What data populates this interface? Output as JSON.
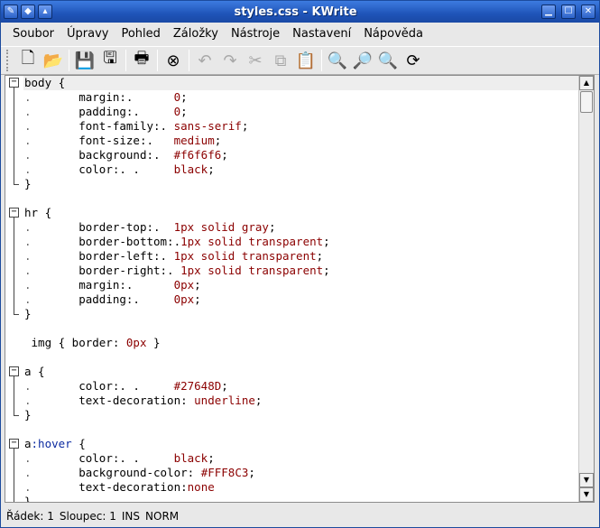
{
  "window": {
    "title": "styles.css - KWrite"
  },
  "menu": [
    "Soubor",
    "Úpravy",
    "Pohled",
    "Záložky",
    "Nástroje",
    "Nastavení",
    "Nápověda"
  ],
  "toolbar": [
    {
      "name": "new-document-icon",
      "glyph": "🗋",
      "enabled": true
    },
    {
      "name": "open-folder-icon",
      "glyph": "📂",
      "enabled": true
    },
    {
      "sep": true
    },
    {
      "name": "save-icon",
      "glyph": "💾",
      "enabled": true
    },
    {
      "name": "save-as-icon",
      "glyph": "🖫",
      "enabled": true
    },
    {
      "sep": true
    },
    {
      "name": "print-icon",
      "glyph": "🖶",
      "enabled": true
    },
    {
      "sep": true
    },
    {
      "name": "close-document-icon",
      "glyph": "⊗",
      "enabled": true
    },
    {
      "sep": true
    },
    {
      "name": "undo-icon",
      "glyph": "↶",
      "enabled": false
    },
    {
      "name": "redo-icon",
      "glyph": "↷",
      "enabled": false
    },
    {
      "name": "cut-icon",
      "glyph": "✂",
      "enabled": false
    },
    {
      "name": "copy-icon",
      "glyph": "⧉",
      "enabled": false
    },
    {
      "name": "paste-icon",
      "glyph": "📋",
      "enabled": true
    },
    {
      "sep": true
    },
    {
      "name": "find-icon",
      "glyph": "🔍",
      "enabled": true
    },
    {
      "name": "find-next-icon",
      "glyph": "🔎",
      "enabled": true
    },
    {
      "name": "find-previous-icon",
      "glyph": "🔍",
      "enabled": true
    },
    {
      "name": "replace-icon",
      "glyph": "⟳",
      "enabled": true
    }
  ],
  "code_lines": [
    [
      {
        "t": "body {",
        "c": "k"
      }
    ],
    [
      {
        "t": ".       ",
        "c": "tabmark"
      },
      {
        "t": "margin:.      ",
        "c": "k"
      },
      {
        "t": "0",
        "c": "v"
      },
      {
        "t": ";",
        "c": "k"
      }
    ],
    [
      {
        "t": ".       ",
        "c": "tabmark"
      },
      {
        "t": "padding:.     ",
        "c": "k"
      },
      {
        "t": "0",
        "c": "v"
      },
      {
        "t": ";",
        "c": "k"
      }
    ],
    [
      {
        "t": ".       ",
        "c": "tabmark"
      },
      {
        "t": "font-family:. ",
        "c": "k"
      },
      {
        "t": "sans-serif",
        "c": "v"
      },
      {
        "t": ";",
        "c": "k"
      }
    ],
    [
      {
        "t": ".       ",
        "c": "tabmark"
      },
      {
        "t": "font-size:.   ",
        "c": "k"
      },
      {
        "t": "medium",
        "c": "v"
      },
      {
        "t": ";",
        "c": "k"
      }
    ],
    [
      {
        "t": ".       ",
        "c": "tabmark"
      },
      {
        "t": "background:.  ",
        "c": "k"
      },
      {
        "t": "#f6f6f6",
        "c": "v"
      },
      {
        "t": ";",
        "c": "k"
      }
    ],
    [
      {
        "t": ".       ",
        "c": "tabmark"
      },
      {
        "t": "color:. .     ",
        "c": "k"
      },
      {
        "t": "black",
        "c": "v"
      },
      {
        "t": ";",
        "c": "k"
      }
    ],
    [
      {
        "t": "}",
        "c": "k"
      }
    ],
    [],
    [
      {
        "t": "hr {",
        "c": "k"
      }
    ],
    [
      {
        "t": ".       ",
        "c": "tabmark"
      },
      {
        "t": "border-top:.  ",
        "c": "k"
      },
      {
        "t": "1px solid gray",
        "c": "v"
      },
      {
        "t": ";",
        "c": "k"
      }
    ],
    [
      {
        "t": ".       ",
        "c": "tabmark"
      },
      {
        "t": "border-bottom:.",
        "c": "k"
      },
      {
        "t": "1px solid transparent",
        "c": "v"
      },
      {
        "t": ";",
        "c": "k"
      }
    ],
    [
      {
        "t": ".       ",
        "c": "tabmark"
      },
      {
        "t": "border-left:. ",
        "c": "k"
      },
      {
        "t": "1px solid transparent",
        "c": "v"
      },
      {
        "t": ";",
        "c": "k"
      }
    ],
    [
      {
        "t": ".       ",
        "c": "tabmark"
      },
      {
        "t": "border-right:.",
        "c": "k"
      },
      {
        "t": " 1px solid transparent",
        "c": "v"
      },
      {
        "t": ";",
        "c": "k"
      }
    ],
    [
      {
        "t": ".       ",
        "c": "tabmark"
      },
      {
        "t": "margin:.      ",
        "c": "k"
      },
      {
        "t": "0px",
        "c": "v"
      },
      {
        "t": ";",
        "c": "k"
      }
    ],
    [
      {
        "t": ".       ",
        "c": "tabmark"
      },
      {
        "t": "padding:.     ",
        "c": "k"
      },
      {
        "t": "0px",
        "c": "v"
      },
      {
        "t": ";",
        "c": "k"
      }
    ],
    [
      {
        "t": "}",
        "c": "k"
      }
    ],
    [],
    [
      {
        "t": " img { border: ",
        "c": "k"
      },
      {
        "t": "0px",
        "c": "v"
      },
      {
        "t": " }",
        "c": "k"
      }
    ],
    [],
    [
      {
        "t": "a {",
        "c": "k"
      }
    ],
    [
      {
        "t": ".       ",
        "c": "tabmark"
      },
      {
        "t": "color:. .     ",
        "c": "k"
      },
      {
        "t": "#27648D",
        "c": "v"
      },
      {
        "t": ";",
        "c": "k"
      }
    ],
    [
      {
        "t": ".       ",
        "c": "tabmark"
      },
      {
        "t": "text-decoration: ",
        "c": "k"
      },
      {
        "t": "underline",
        "c": "v"
      },
      {
        "t": ";",
        "c": "k"
      }
    ],
    [
      {
        "t": "}",
        "c": "k"
      }
    ],
    [],
    [
      {
        "t": "a",
        "c": "k"
      },
      {
        "t": ":hover",
        "c": "sel"
      },
      {
        "t": " {",
        "c": "k"
      }
    ],
    [
      {
        "t": ".       ",
        "c": "tabmark"
      },
      {
        "t": "color:. .     ",
        "c": "k"
      },
      {
        "t": "black",
        "c": "v"
      },
      {
        "t": ";",
        "c": "k"
      }
    ],
    [
      {
        "t": ".       ",
        "c": "tabmark"
      },
      {
        "t": "background-color: ",
        "c": "k"
      },
      {
        "t": "#FFF8C3",
        "c": "v"
      },
      {
        "t": ";",
        "c": "k"
      }
    ],
    [
      {
        "t": ".       ",
        "c": "tabmark"
      },
      {
        "t": "text-decoration:",
        "c": "k"
      },
      {
        "t": "none",
        "c": "v"
      }
    ],
    [
      {
        "t": "}",
        "c": "k"
      }
    ]
  ],
  "folds": [
    [
      0,
      7
    ],
    [
      9,
      16
    ],
    [
      20,
      23
    ],
    [
      25,
      29
    ]
  ],
  "statusbar": {
    "line": "Řádek: 1",
    "col": "Sloupec: 1",
    "mode": "INS",
    "norm": "NORM"
  }
}
